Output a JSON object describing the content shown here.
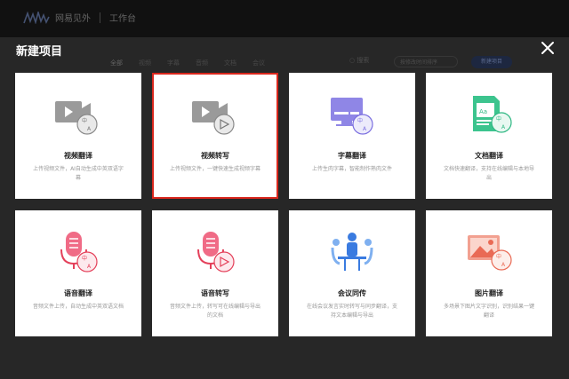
{
  "app": {
    "brand": "网易见外",
    "workspace": "工作台"
  },
  "underlying": {
    "tabs": [
      "全部",
      "视频",
      "字幕",
      "音频",
      "文档",
      "会议"
    ],
    "search_label": "搜索",
    "sort_label": "按修改时间排序",
    "new_project_label": "新建项目"
  },
  "modal": {
    "title": "新建项目",
    "cards": [
      {
        "id": "video-translate",
        "title": "视频翻译",
        "desc": "上传视频文件，AI自动生成中英双语字幕",
        "icon": "video-translate-icon",
        "selected": false
      },
      {
        "id": "video-transcribe",
        "title": "视频转写",
        "desc": "上传视频文件，一键快速生成视频字幕",
        "icon": "video-transcribe-icon",
        "selected": true
      },
      {
        "id": "subtitle-translate",
        "title": "字幕翻译",
        "desc": "上传生肉字幕，智能制作熟肉文件",
        "icon": "subtitle-translate-icon",
        "selected": false
      },
      {
        "id": "doc-translate",
        "title": "文档翻译",
        "desc": "文档快速翻译，支持在线编辑与本地导出",
        "icon": "document-translate-icon",
        "selected": false
      },
      {
        "id": "speech-translate",
        "title": "语音翻译",
        "desc": "音频文件上传，自动生成中英双语文档",
        "icon": "speech-translate-icon",
        "selected": false
      },
      {
        "id": "speech-transcribe",
        "title": "语音转写",
        "desc": "音频文件上传，转写可在线编辑与导出的文档",
        "icon": "speech-transcribe-icon",
        "selected": false
      },
      {
        "id": "meeting-interpret",
        "title": "会议同传",
        "desc": "在线会议发言实时转写与同步翻译，支持文本编辑与导出",
        "icon": "meeting-interpret-icon",
        "selected": false
      },
      {
        "id": "image-translate",
        "title": "图片翻译",
        "desc": "多场景下图片文字识别，识别结果一键翻译",
        "icon": "image-translate-icon",
        "selected": false
      }
    ]
  },
  "colors": {
    "selected_border": "#d9261c",
    "accent_purple": "#7b6fe0",
    "accent_green": "#2fb883",
    "accent_red": "#e4405a",
    "accent_blue": "#3a7be0"
  }
}
